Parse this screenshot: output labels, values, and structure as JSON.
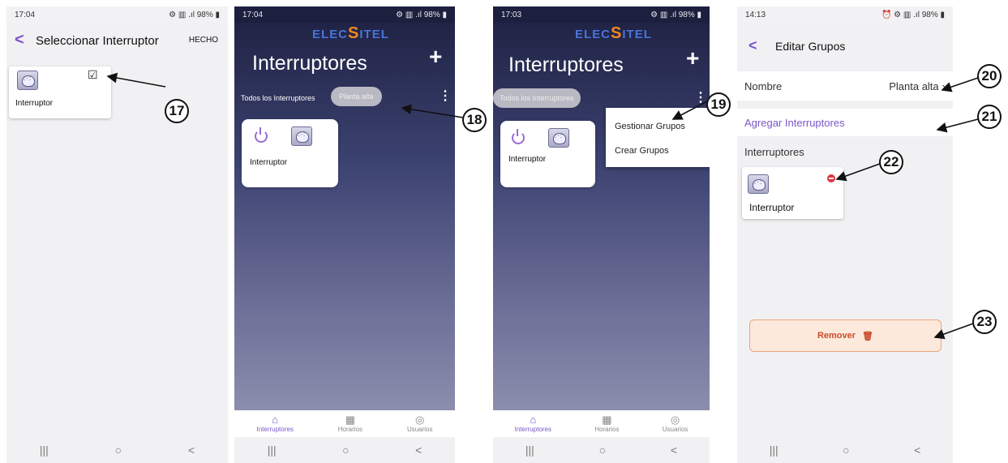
{
  "screen1": {
    "status_time": "17:04",
    "status_right": "98%",
    "back": "<",
    "title": "Seleccionar Interruptor",
    "done": "HECHO",
    "check": "☑",
    "card_label": "Interruptor",
    "callout": "17"
  },
  "screen2": {
    "status_time": "17:04",
    "status_right": "98%",
    "logo_a": "ELEC",
    "logo_s": "S",
    "logo_b": "ITEL",
    "title": "Interruptores",
    "plus": "+",
    "filter_all": "Todos los Interruptores",
    "filter_group": "Planta alta",
    "kebab": "⋮",
    "card_label": "Interruptor",
    "callout": "18",
    "tabs": [
      {
        "icon": "⌂",
        "label": "Interruptores"
      },
      {
        "icon": "▦",
        "label": "Horarios"
      },
      {
        "icon": "◎",
        "label": "Usuarios"
      }
    ]
  },
  "screen3": {
    "status_time": "17:03",
    "status_right": "98%",
    "logo_a": "ELEC",
    "logo_s": "S",
    "logo_b": "ITEL",
    "title": "Interruptores",
    "plus": "+",
    "filter_all": "Todos los Interruptores",
    "kebab": "⋮",
    "card_label": "Interruptor",
    "menu": [
      "Gestionar Grupos",
      "Crear Grupos"
    ],
    "callout": "19",
    "tabs": [
      {
        "icon": "⌂",
        "label": "Interruptores"
      },
      {
        "icon": "▦",
        "label": "Horarios"
      },
      {
        "icon": "◎",
        "label": "Usuarios"
      }
    ]
  },
  "screen4": {
    "status_time": "14:13",
    "status_right": "98%",
    "back": "<",
    "title": "Editar Grupos",
    "name_label": "Nombre",
    "name_value": "Planta alta",
    "chevron": "›",
    "add_label": "Agregar Interruptores",
    "list_header": "Interruptores",
    "card_label": "Interruptor",
    "remove_label": "Remover",
    "trash": "🗑",
    "callouts": [
      "20",
      "21",
      "22",
      "23"
    ]
  },
  "nav": {
    "recent": "|||",
    "home": "○",
    "back": "<"
  },
  "colors": {
    "accent": "#7a55c8",
    "remove_bg": "#fde9dc",
    "remove_border": "#e6a57e",
    "remove_text": "#c94a2a",
    "minus_badge": "#d9363e"
  }
}
